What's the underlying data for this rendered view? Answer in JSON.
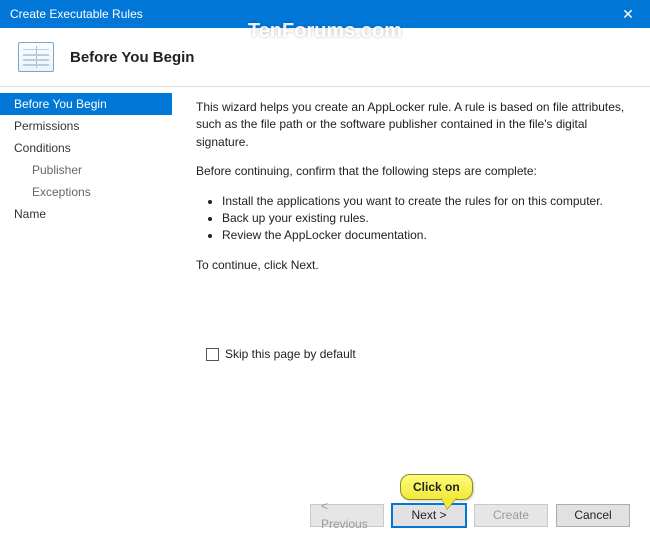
{
  "titlebar": {
    "title": "Create Executable Rules"
  },
  "watermark": "TenForums.com",
  "header": {
    "title": "Before You Begin"
  },
  "sidebar": {
    "items": [
      {
        "label": "Before You Begin",
        "selected": true
      },
      {
        "label": "Permissions"
      },
      {
        "label": "Conditions"
      },
      {
        "label": "Publisher",
        "sub": true
      },
      {
        "label": "Exceptions",
        "sub": true
      },
      {
        "label": "Name"
      }
    ]
  },
  "content": {
    "intro": "This wizard helps you create an AppLocker rule. A rule is based on file attributes, such as the file path or the software publisher contained in the file's digital signature.",
    "before_line": "Before continuing, confirm that the following steps are complete:",
    "bullets": [
      "Install the applications you want to create the rules for on this computer.",
      "Back up your existing rules.",
      "Review the AppLocker documentation."
    ],
    "continue_line": "To continue, click Next.",
    "skip_label": "Skip this page by default"
  },
  "footer": {
    "previous": "< Previous",
    "next": "Next >",
    "create": "Create",
    "cancel": "Cancel"
  },
  "callout": {
    "text": "Click on"
  }
}
